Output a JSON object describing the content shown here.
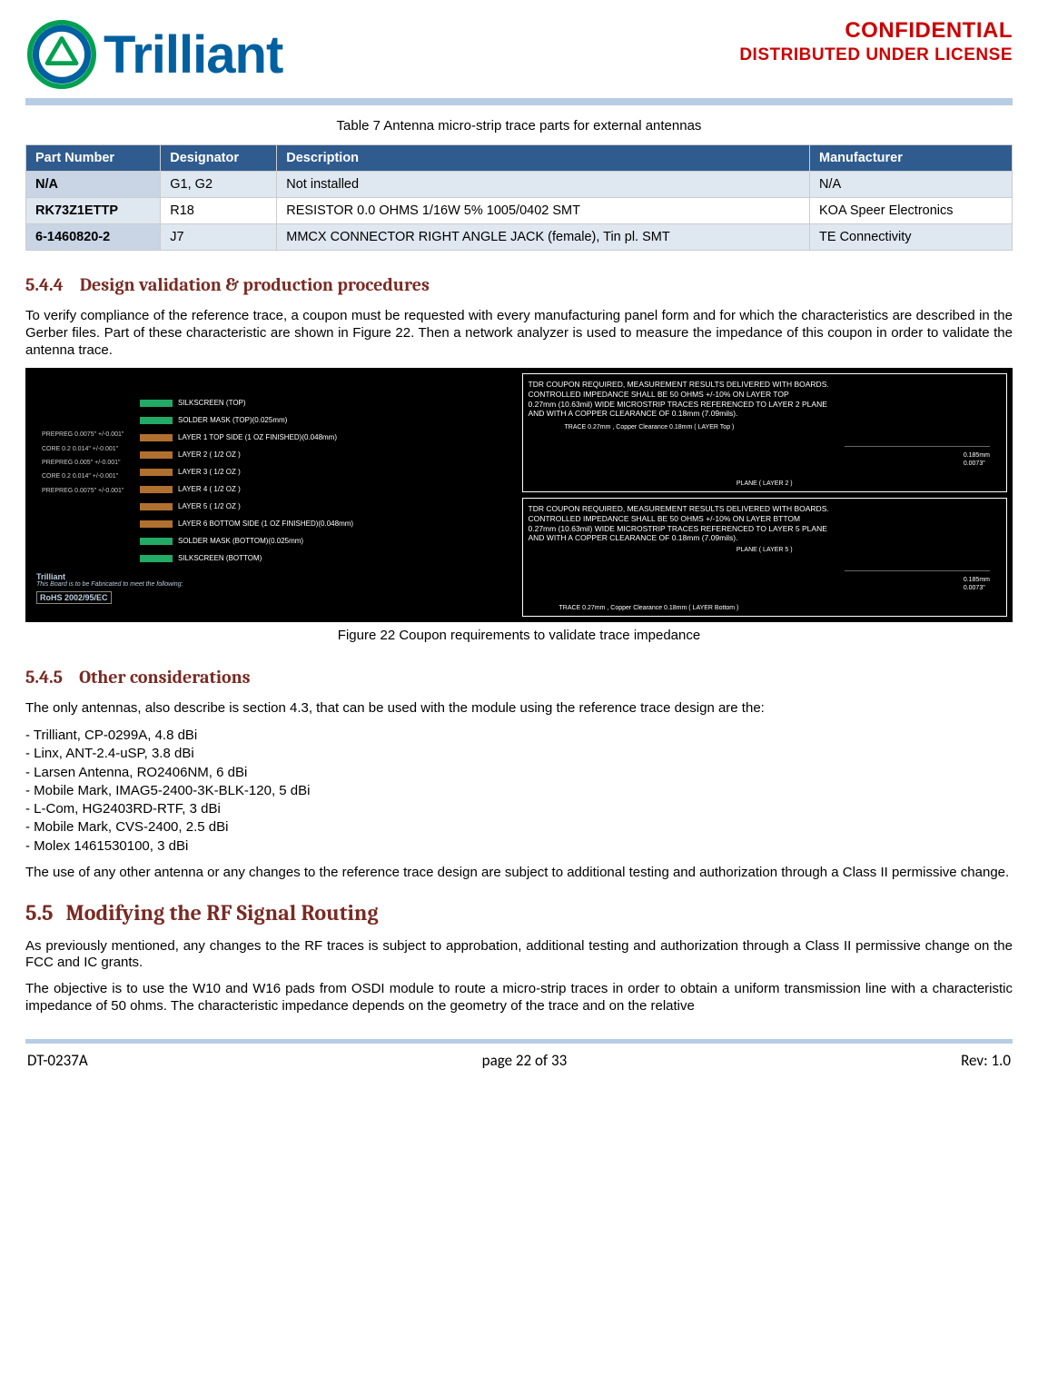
{
  "header": {
    "logo_text": "Trilliant",
    "confidential": "CONFIDENTIAL",
    "distributed": "DISTRIBUTED UNDER LICENSE"
  },
  "table": {
    "caption": "Table 7  Antenna micro-strip trace parts for external antennas",
    "headers": [
      "Part Number",
      "Designator",
      "Description",
      "Manufacturer"
    ],
    "rows": [
      {
        "pn": "N/A",
        "desig": "G1, G2",
        "desc": "Not installed",
        "mfr": "N/A"
      },
      {
        "pn": "RK73Z1ETTP",
        "desig": "R18",
        "desc": "RESISTOR 0.0 OHMS 1/16W 5% 1005/0402 SMT",
        "mfr": "KOA Speer Electronics"
      },
      {
        "pn": "6-1460820-2",
        "desig": "J7",
        "desc": "MMCX CONNECTOR RIGHT ANGLE JACK (female), Tin pl. SMT",
        "mfr": "TE Connectivity"
      }
    ]
  },
  "sec544": {
    "num": "5.4.4",
    "title": "Design validation & production procedures",
    "para": "To verify compliance of the reference trace, a coupon must be requested with every manufacturing panel form and for which the characteristics are described in the Gerber files.  Part of these characteristic are shown in Figure 22.  Then a network analyzer is used to measure the impedance of this coupon in order to validate the antenna trace."
  },
  "figure22": {
    "left": {
      "silkscreen_top": "SILKSCREEN (TOP)",
      "solder_top": "SOLDER MASK (TOP)(0.025mm)",
      "l1": "LAYER 1 TOP SIDE (1 OZ FINISHED)(0.048mm)",
      "l2": "LAYER 2 ( 1/2 OZ )",
      "l3": "LAYER 3 ( 1/2 OZ )",
      "l4": "LAYER 4 ( 1/2 OZ )",
      "l5": "LAYER 5 ( 1/2 OZ )",
      "l6": "LAYER 6 BOTTOM SIDE (1 OZ FINISHED)(0.048mm)",
      "solder_bot": "SOLDER MASK (BOTTOM)(0.025mm)",
      "silkscreen_bot": "SILKSCREEN (BOTTOM)",
      "p1": "PREPREG\n0.0075\" +/-0.001\"",
      "p2": "CORE 0.2\n0.014\" +/-0.001\"",
      "p3": "PREPREG\n0.005\" +/-0.001\"",
      "p4": "CORE 0.2\n0.014\" +/-0.001\"",
      "p5": "PREPREG\n0.0075\" +/-0.001\"",
      "badge1": "Trilliant",
      "badge2": "This Board is to be Fabricated\nto meet the following:",
      "rohs": "RoHS\n2002/95/EC"
    },
    "right_top": {
      "l1": "TDR COUPON REQUIRED, MEASUREMENT RESULTS DELIVERED WITH BOARDS.",
      "l2": "CONTROLLED IMPEDANCE SHALL BE 50 OHMS +/-10% ON LAYER TOP",
      "l3": "0.27mm (10.63mil) WIDE MICROSTRIP TRACES REFERENCED TO LAYER 2 PLANE",
      "l4": "AND WITH A COPPER CLEARANCE OF 0.18mm (7.09mils).",
      "trace": "TRACE 0.27mm , Copper Clearance 0.18mm ( LAYER Top )",
      "plane": "PLANE ( LAYER 2 )",
      "dim1": "0.185mm",
      "dim2": "0.0073\""
    },
    "right_bot": {
      "l1": "TDR COUPON REQUIRED, MEASUREMENT RESULTS DELIVERED WITH BOARDS.",
      "l2": "CONTROLLED IMPEDANCE SHALL BE 50 OHMS +/-10% ON LAYER BTTOM",
      "l3": "0.27mm (10.63mil) WIDE MICROSTRIP TRACES REFERENCED TO LAYER 5 PLANE",
      "l4": "AND WITH A COPPER CLEARANCE OF 0.18mm (7.09mils).",
      "plane": "PLANE ( LAYER 5 )",
      "trace": "TRACE 0.27mm , Copper Clearance 0.18mm ( LAYER Bottom )",
      "dim1": "0.185mm",
      "dim2": "0.0073\""
    },
    "caption": "Figure 22  Coupon requirements to validate trace impedance"
  },
  "sec545": {
    "num": "5.4.5",
    "title": "Other considerations",
    "para1": "The only antennas, also describe is section 4.3, that can be used with the module using the reference trace design are the:",
    "antennas": [
      "Trilliant, CP-0299A, 4.8 dBi",
      "Linx, ANT-2.4-uSP, 3.8 dBi",
      "Larsen Antenna, RO2406NM, 6 dBi",
      "Mobile Mark, IMAG5-2400-3K-BLK-120, 5 dBi",
      "L-Com, HG2403RD-RTF, 3 dBi",
      "Mobile Mark, CVS-2400, 2.5 dBi",
      "Molex 1461530100, 3 dBi"
    ],
    "para2": "The use of any other antenna or any changes to the reference trace design are subject to additional testing and authorization through a Class II permissive change."
  },
  "sec55": {
    "num": "5.5",
    "title": "Modifying the RF Signal Routing",
    "para1": "As previously mentioned, any changes to the RF traces is subject to approbation, additional testing and authorization through a Class II permissive change on the FCC and IC grants.",
    "para2": "The objective is to use the W10 and W16 pads from OSDI module to route a micro-strip traces in order to obtain a uniform transmission line with a characteristic impedance of 50 ohms.  The characteristic impedance depends on the geometry of the trace and on the relative"
  },
  "footer": {
    "left": "DT-0237A",
    "center": "page 22 of 33",
    "right": "Rev: 1.0"
  }
}
